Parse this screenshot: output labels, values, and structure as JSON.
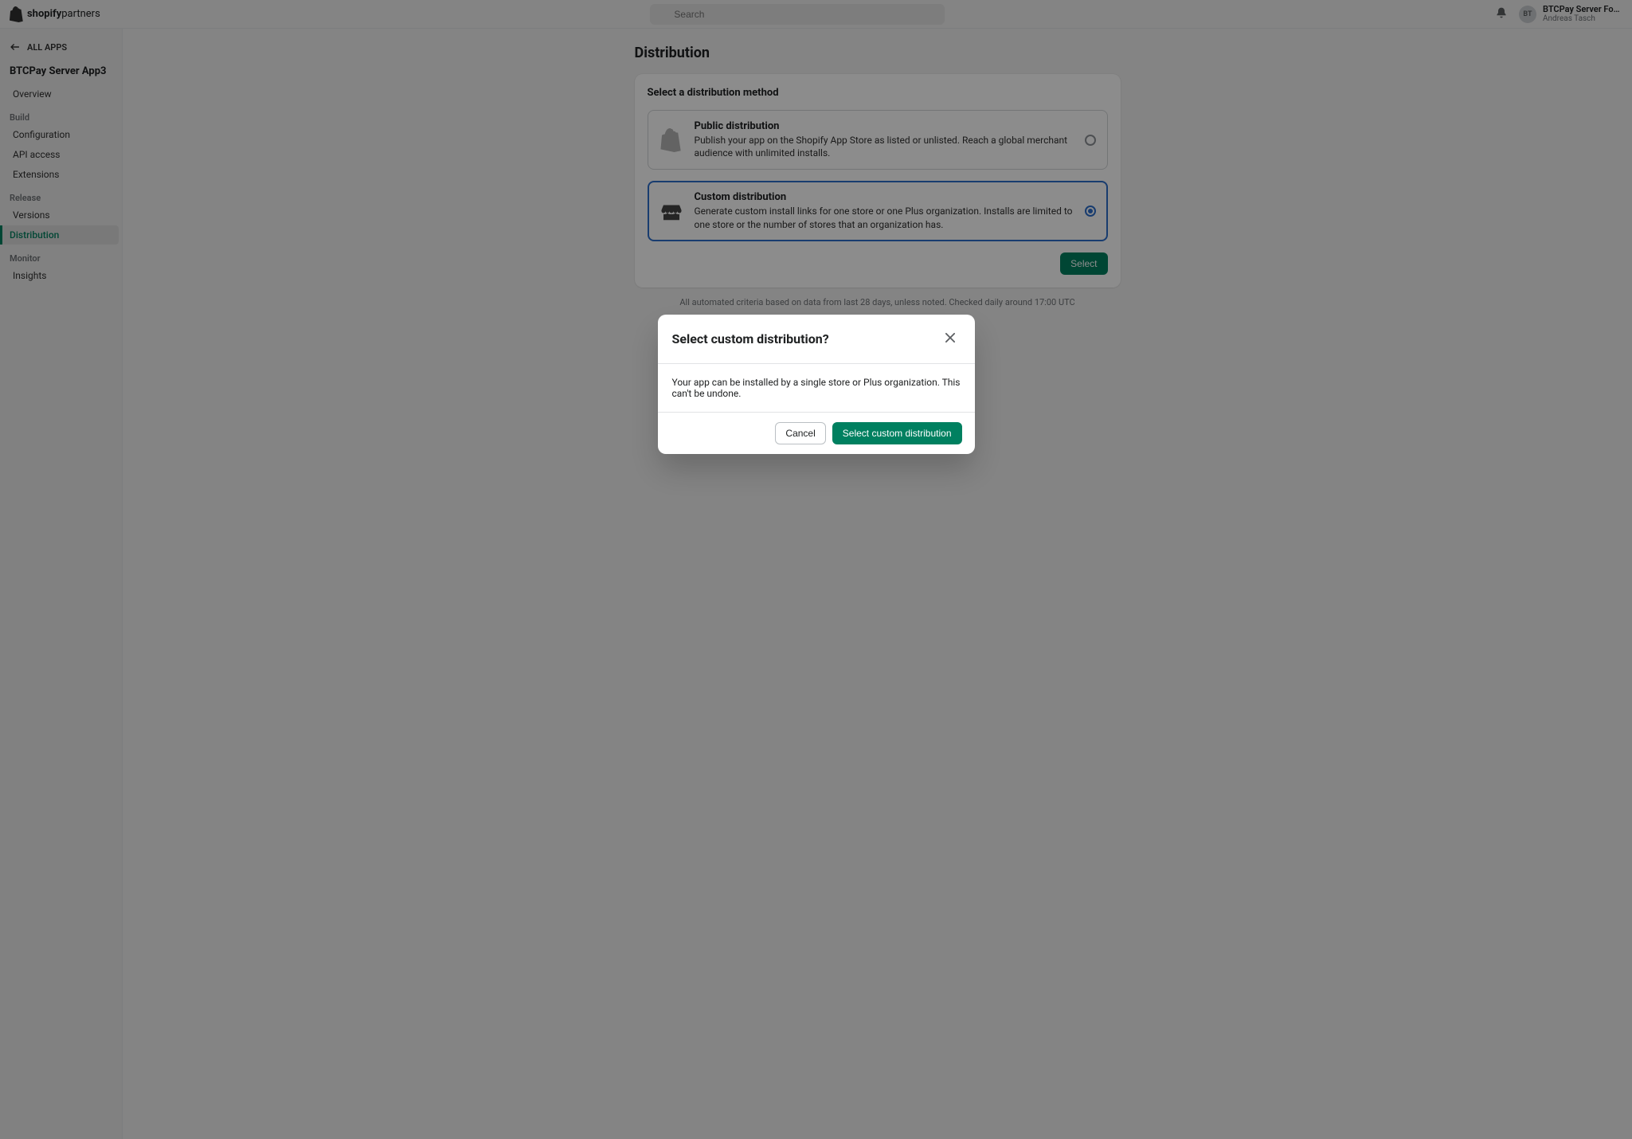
{
  "header": {
    "logo_main": "shopify",
    "logo_sub": "partners",
    "search_placeholder": "Search",
    "org_name": "BTCPay Server Found…",
    "user_name": "Andreas Tasch",
    "avatar_initials": "BT"
  },
  "sidebar": {
    "back_label": "ALL APPS",
    "app_name": "BTCPay Server App3",
    "nav": {
      "overview": "Overview",
      "build_section": "Build",
      "configuration": "Configuration",
      "api_access": "API access",
      "extensions": "Extensions",
      "release_section": "Release",
      "versions": "Versions",
      "distribution": "Distribution",
      "monitor_section": "Monitor",
      "insights": "Insights"
    }
  },
  "page": {
    "title": "Distribution",
    "card_title": "Select a distribution method",
    "options": [
      {
        "title": "Public distribution",
        "desc": "Publish your app on the Shopify App Store as listed or unlisted. Reach a global merchant audience with unlimited installs."
      },
      {
        "title": "Custom distribution",
        "desc": "Generate custom install links for one store or one Plus organization. Installs are limited to one store or the number of stores that an organization has."
      }
    ],
    "select_button": "Select",
    "footnote": "All automated criteria based on data from last 28 days, unless noted. Checked daily around 17:00 UTC"
  },
  "modal": {
    "title": "Select custom distribution?",
    "body": "Your app can be installed by a single store or Plus organization. This can't be undone.",
    "cancel": "Cancel",
    "confirm": "Select custom distribution"
  }
}
